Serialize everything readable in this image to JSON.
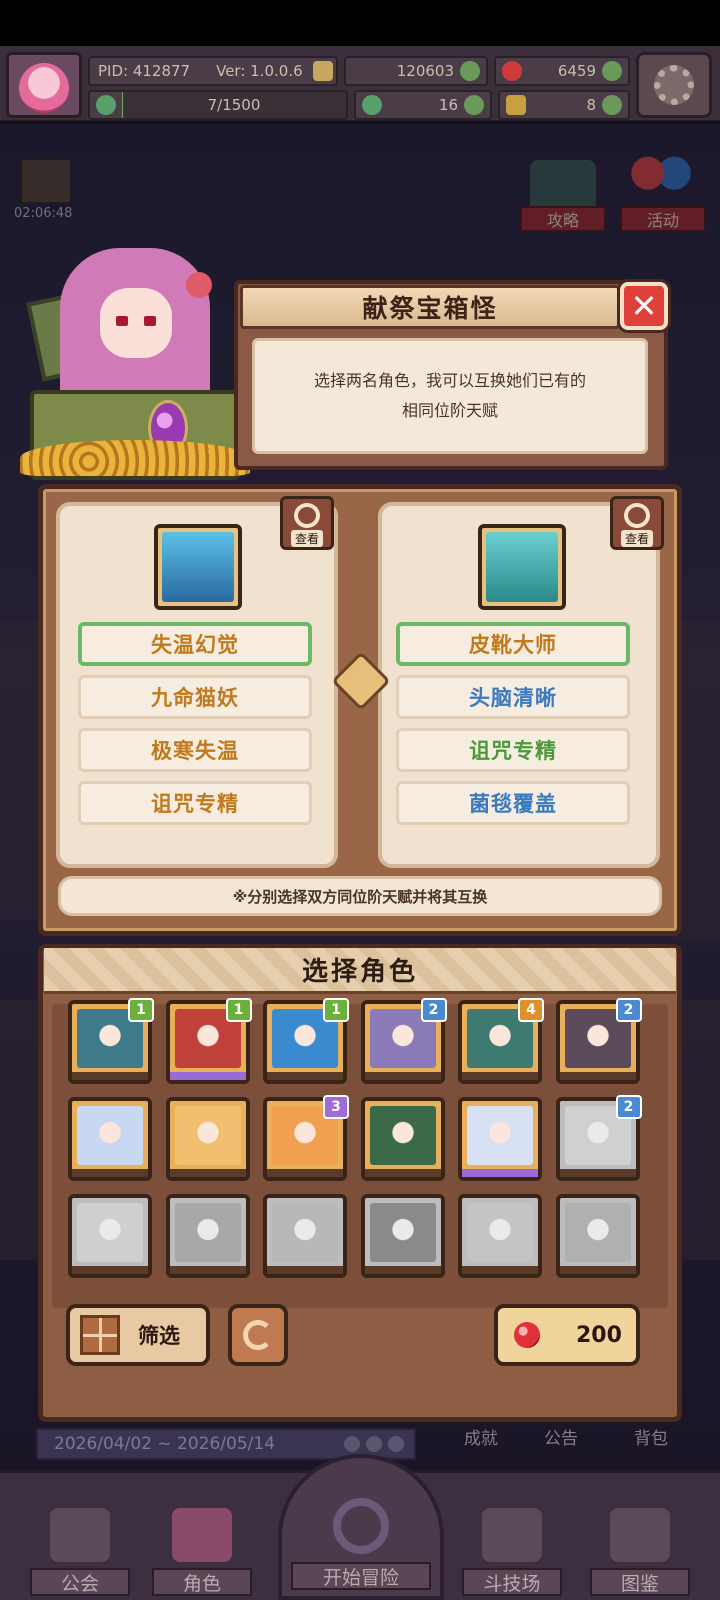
{
  "hud": {
    "pid": "PID: 412877",
    "version": "Ver: 1.0.0.6",
    "gold": "120603",
    "gems": "6459",
    "progress": "7/1500",
    "progress_fraction": 0.0047,
    "clover": "16",
    "notes": "8"
  },
  "event_timer": "02:06:48",
  "side_buttons": {
    "guide": "攻略",
    "activity": "活动"
  },
  "dialog": {
    "title": "献祭宝箱怪",
    "desc_line1": "选择两名角色，我可以互换她们已有的",
    "desc_line2": "相同位阶天赋"
  },
  "swap": {
    "view_label": "查看",
    "left_talents": [
      {
        "label": "失温幻觉",
        "color": "#c07a1c",
        "selected": true
      },
      {
        "label": "九命猫妖",
        "color": "#c07a1c",
        "selected": false
      },
      {
        "label": "极寒失温",
        "color": "#c07a1c",
        "selected": false
      },
      {
        "label": "诅咒专精",
        "color": "#c07a1c",
        "selected": false
      }
    ],
    "right_talents": [
      {
        "label": "皮靴大师",
        "color": "#c07a1c",
        "selected": true
      },
      {
        "label": "头脑清晰",
        "color": "#3a7ac0",
        "selected": false
      },
      {
        "label": "诅咒专精",
        "color": "#4a9a3a",
        "selected": false
      },
      {
        "label": "菌毯覆盖",
        "color": "#3a7ac0",
        "selected": false
      }
    ],
    "note": "※分别选择双方同位阶天赋并将其互换"
  },
  "select": {
    "title": "选择角色",
    "filter_label": "筛选",
    "cost": "200",
    "characters": [
      {
        "level": "1",
        "tier": "g",
        "art": "#3e7a8a",
        "locked": false,
        "bar": ""
      },
      {
        "level": "1",
        "tier": "g",
        "art": "#c0403a",
        "locked": false,
        "bar": "purple"
      },
      {
        "level": "1",
        "tier": "g",
        "art": "#3a8ad0",
        "locked": false,
        "bar": ""
      },
      {
        "level": "2",
        "tier": "b",
        "art": "#8a7ab8",
        "locked": false,
        "bar": ""
      },
      {
        "level": "4",
        "tier": "o",
        "art": "#3e7a70",
        "locked": false,
        "bar": ""
      },
      {
        "level": "2",
        "tier": "b",
        "art": "#5a4a5a",
        "locked": false,
        "bar": ""
      },
      {
        "level": "",
        "tier": "",
        "art": "#c8d8f0",
        "locked": false,
        "bar": ""
      },
      {
        "level": "",
        "tier": "",
        "art": "#f0c070",
        "locked": false,
        "bar": ""
      },
      {
        "level": "3",
        "tier": "p",
        "art": "#f0a050",
        "locked": false,
        "bar": ""
      },
      {
        "level": "",
        "tier": "",
        "art": "#3a6a4a",
        "locked": false,
        "bar": ""
      },
      {
        "level": "",
        "tier": "",
        "art": "#d8e0f4",
        "locked": false,
        "bar": "purple"
      },
      {
        "level": "2",
        "tier": "b",
        "art": "#d0d0d0",
        "locked": true,
        "bar": ""
      },
      {
        "level": "",
        "tier": "",
        "art": "#cfcfcf",
        "locked": true,
        "bar": ""
      },
      {
        "level": "",
        "tier": "",
        "art": "#a8a8a8",
        "locked": true,
        "bar": ""
      },
      {
        "level": "",
        "tier": "",
        "art": "#b8b8b8",
        "locked": true,
        "bar": ""
      },
      {
        "level": "",
        "tier": "",
        "art": "#8a8a8a",
        "locked": true,
        "bar": ""
      },
      {
        "level": "",
        "tier": "",
        "art": "#c4c4c4",
        "locked": true,
        "bar": ""
      },
      {
        "level": "",
        "tier": "",
        "art": "#b0b0b0",
        "locked": true,
        "bar": ""
      }
    ]
  },
  "background": {
    "date_range": "2026/04/02 ~ 2026/05/14",
    "achievement": "成就",
    "notice": "公告",
    "backpack": "背包"
  },
  "nav": {
    "guild": "公会",
    "character": "角色",
    "adventure": "开始冒险",
    "arena": "斗技场",
    "codex": "图鉴"
  }
}
